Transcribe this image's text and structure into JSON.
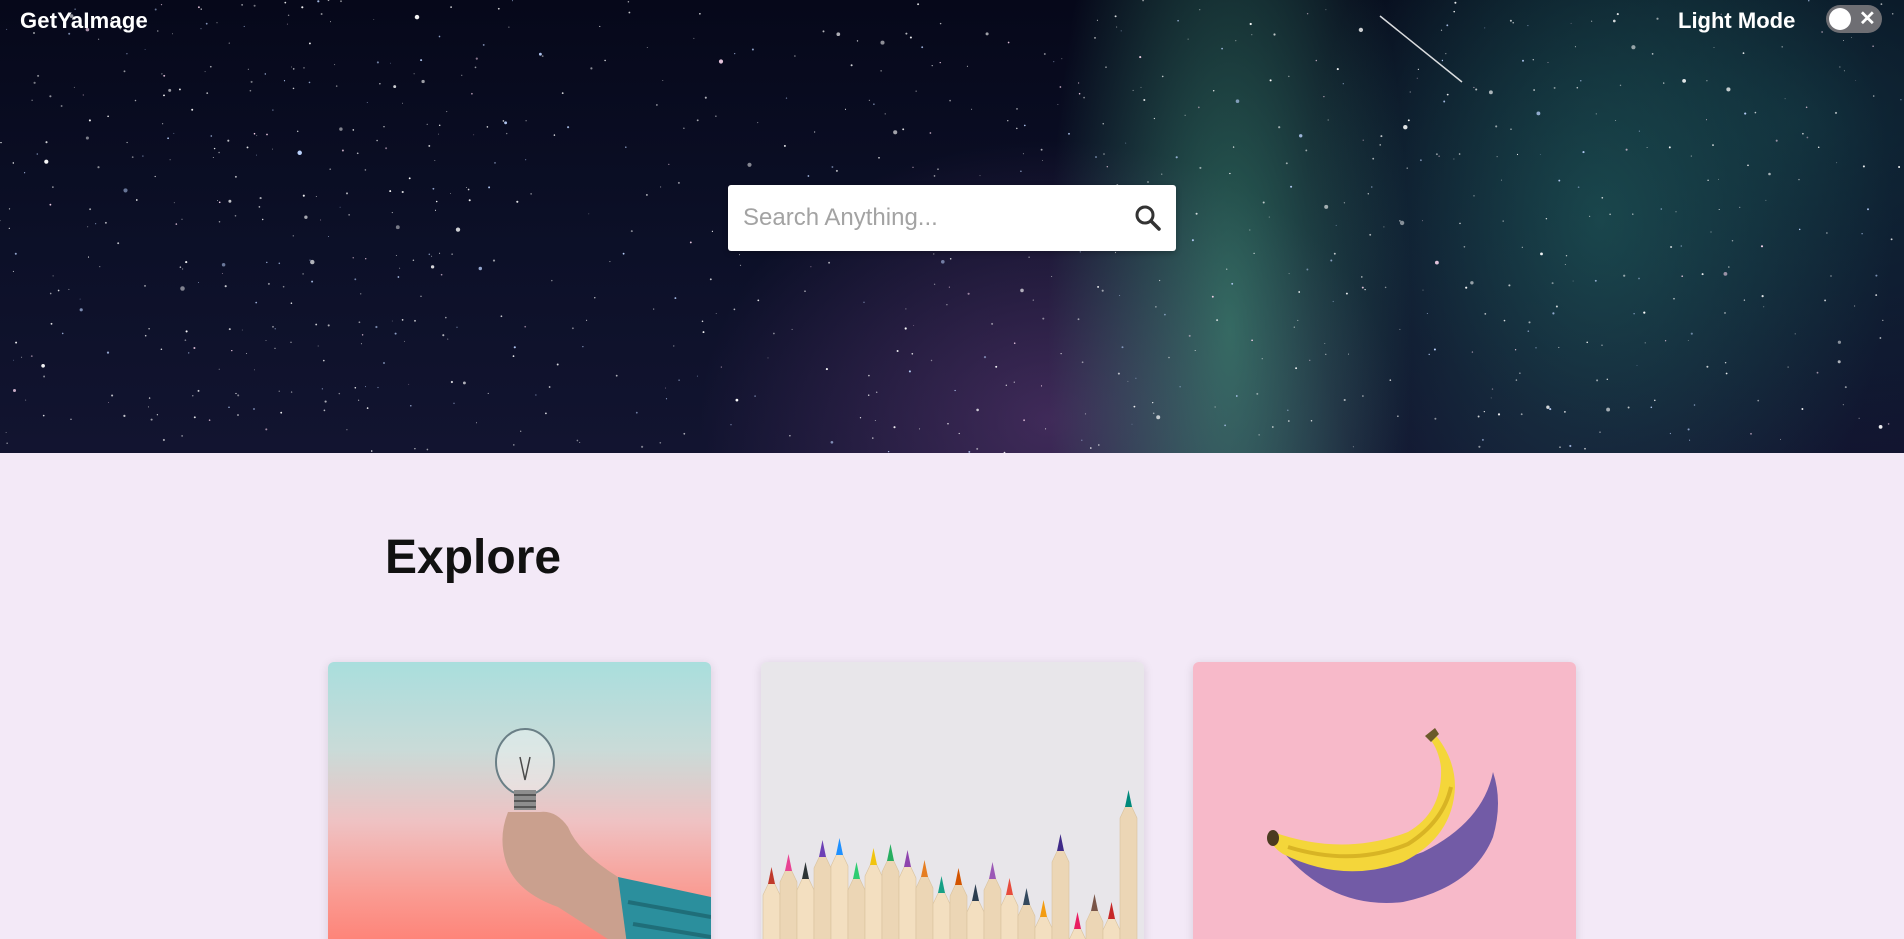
{
  "header": {
    "logo_text": "GetYaImage",
    "mode_label": "Light Mode",
    "toggle_icon": "close-icon"
  },
  "search": {
    "placeholder": "Search Anything...",
    "value": "",
    "icon": "search-icon"
  },
  "explore": {
    "title": "Explore",
    "cards": [
      {
        "name": "lightbulb-in-hand-image",
        "alt": "Hand holding a lightbulb"
      },
      {
        "name": "colored-pencils-image",
        "alt": "Colored pencils"
      },
      {
        "name": "banana-image",
        "alt": "Banana on pink background"
      }
    ]
  },
  "colors": {
    "page_background": "#f3e9f7",
    "title_text": "#111111",
    "header_text": "#ffffff"
  }
}
